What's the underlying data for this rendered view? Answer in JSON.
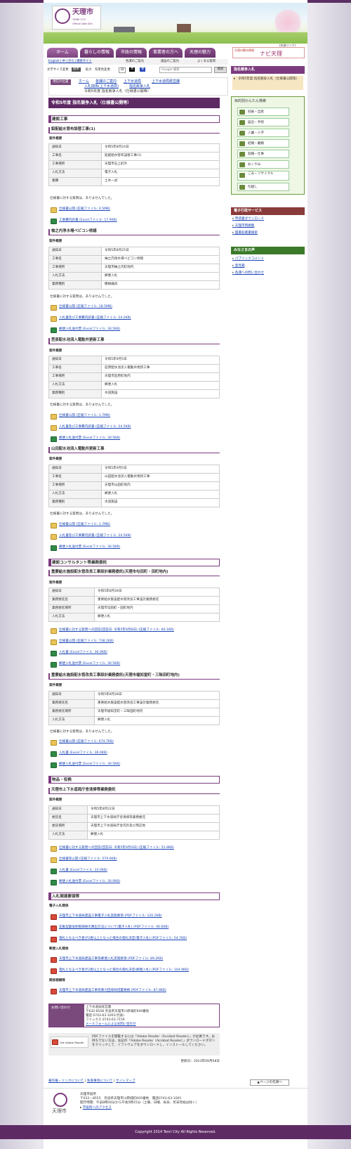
{
  "site": {
    "logo": "天理市",
    "logo_sub": "TENRI CITY",
    "logo_sub2": "Official Web Site"
  },
  "nav": [
    "ホーム",
    "暮らしの情報",
    "市政の情報",
    "事業者の方へ",
    "天理の魅力"
  ],
  "naviban": {
    "small": "天理の観光情報",
    "big": "ナビ天理",
    "tag": "(外部リンク)"
  },
  "util": {
    "lang": "English | 中 | 한국 | 携帯サイト",
    "l1": "各課のご案内",
    "l2": "施設のご案内",
    "l3": "よくある質問"
  },
  "tool": {
    "size_label": "文字サイズ変更",
    "std": "標準",
    "big": "拡大",
    "bg": "背景色変更",
    "b1": "白",
    "b2": "黒",
    "b3": "青",
    "search_ph": "Google 検索",
    "search_btn": "検索"
  },
  "crumb": {
    "label": "現在の位置",
    "c1": "ホーム",
    "c2": "各課のご案内",
    "c3": "上下水道局",
    "c4": "上下水道局経営課",
    "c5": "入札関係(上下水道局)",
    "c6": "指名競争入札",
    "c7": "令和5年度 指名競争入札（仕様書公開等）"
  },
  "title": "令和5年度 指名競争入札（仕様書公開等）",
  "sections": {
    "s1": "建設工事",
    "s2": "建設コンサルタント等業務委託",
    "s3": "物品・役務",
    "s4": "入札関連要領等"
  },
  "overview": "案件概要",
  "noq": "仕様書に対する質問は、ありませんでした。",
  "p1": {
    "h": "鉛配給水管布設替工事(1)",
    "rows": [
      [
        "通知日",
        "令和5年8月24日"
      ],
      [
        "工事名",
        "鉛配給水管布設替工事(1)"
      ],
      [
        "工事場所",
        "天理市石上町外"
      ],
      [
        "入札方法",
        "電子入札"
      ],
      [
        "業種",
        "土木一式"
      ]
    ],
    "f1": "仕様書公開 (圧縮ファイル: 4.5MB)",
    "f2": "工事費内訳書 (Excelファイル: 17.9KB)"
  },
  "p2": {
    "h": "柚之内浄水場ベビコン修繕",
    "rows": [
      [
        "通知日",
        "令和5年8月25日"
      ],
      [
        "工事名",
        "柚之内浄水場ベビコン修繕"
      ],
      [
        "工事場所",
        "天理市柚之内町地内"
      ],
      [
        "入札方法",
        "郵便入札"
      ],
      [
        "業務種別",
        "機械器具"
      ]
    ],
    "f1": "仕様書公開 (圧縮ファイル: 18.5MB)",
    "f2": "入札書及び工事費内訳書 (圧縮ファイル: 24.2KB)",
    "f3": "郵便入札送付票 (Excelファイル: 30.5KB)"
  },
  "p3": {
    "h": "苣原配水池流入電動弁更新工事",
    "rows": [
      [
        "通知日",
        "令和5年9月5日"
      ],
      [
        "工事名",
        "苣原配水池流入電動弁更新工事"
      ],
      [
        "工事場所",
        "天理市苣原町地内"
      ],
      [
        "入札方法",
        "郵便入札"
      ],
      [
        "業務種別",
        "水道施設"
      ]
    ],
    "f1": "仕様書公開 (圧縮ファイル: 1.7MB)",
    "f2": "入札書及び工事費内訳書 (圧縮ファイル: 24.5KB)",
    "f3": "郵便入札送付票 (Excelファイル: 30.5KB)"
  },
  "p4": {
    "h": "山田配水池流入電動弁更新工事",
    "rows": [
      [
        "通知日",
        "令和5年9月5日"
      ],
      [
        "工事名",
        "山田配水池流入電動弁更新工事"
      ],
      [
        "工事場所",
        "天理市山田町地内"
      ],
      [
        "入札方法",
        "郵便入札"
      ],
      [
        "業務種別",
        "水道施設"
      ]
    ],
    "f1": "仕様書公開 (圧縮ファイル: 1.7MB)",
    "f2": "入札書及び工事費内訳書 (圧縮ファイル: 24.5KB)",
    "f3": "郵便入札送付票 (Excelファイル: 30.5KB)"
  },
  "p5": {
    "h": "重要給水施設配水管改良工事設計業務委託(天理市勾田町・田町地内)",
    "rows": [
      [
        "通知日",
        "令和5年8月28日"
      ],
      [
        "業務委託名",
        "重要給水施設配水管改良工事設計業務委託"
      ],
      [
        "業務委託場所",
        "天理市勾田町・田町地内"
      ],
      [
        "入札方法",
        "郵便入札"
      ]
    ],
    "f0": "仕様書に対する質問への回答(回答日: 令和5年9月8日) (圧縮ファイル: 60.1KB)",
    "f1": "仕様書公開 (圧縮ファイル: 738.2KB)",
    "f2": "入札書 (Excelファイル: 36.0KB)",
    "f3": "郵便入札送付票 (Excelファイル: 30.5KB)"
  },
  "p6": {
    "h": "重要給水施設配水管改良工事設計業務委託(天理市福知堂町・三昧田町地内)",
    "rows": [
      [
        "通知日",
        "令和5年8月28日"
      ],
      [
        "業務委託名",
        "重要給水施設配水管改良工事設計業務委託"
      ],
      [
        "業務委託場所",
        "天理市福知堂町・三昧田町地内"
      ],
      [
        "入札方法",
        "郵便入札"
      ]
    ],
    "f1": "仕様書公開 (圧縮ファイル: 674.7KB)",
    "f2": "入札書 (Excelファイル: 36.0KB)",
    "f3": "郵便入札送付票 (Excelファイル: 30.5KB)"
  },
  "p7": {
    "h": "天理市上下水道局庁舎清掃等業務委託",
    "rows": [
      [
        "通知日",
        "令和5年8月22日"
      ],
      [
        "委託名",
        "天理市上下水道局庁舎清掃等業務委託"
      ],
      [
        "委託場所",
        "天理市上下水道局庁舎内外及び周辺地"
      ],
      [
        "入札方法",
        "郵便入札"
      ]
    ],
    "f0": "仕様書に対する質問への回答(回答日: 令和5年9月4日) (圧縮ファイル: 52.8KB)",
    "f1": "仕様書等公開 (圧縮ファイル: 579.6KB)",
    "f2": "入札書 (Excelファイル: 33.0KB)",
    "f3": "郵便入札送付票 (Excelファイル: 30.0KB)"
  },
  "rel": {
    "h1": "電子入札関係",
    "e1": "天理市上下水道局建設工事電子入札実施要領 (PDFファイル: 120.2KB)",
    "e2": "変動型最低制限価格の算出方法について(電子入札) (PDFファイル: 46.6KB)",
    "e3": "落札となるべき者が2者以上となった場合の落札決定(電子入札) (PDFファイル: 54.7KB)",
    "h2": "郵便入札関係",
    "m1": "天理市上下水道局建設工事等郵便入札実施要領 (PDFファイル: 89.2KB)",
    "m2": "落札となるべき者が2者以上となった場合の落札決定(郵便入札) (PDFファイル: 104.9KB)",
    "h3": "関係要綱等",
    "k1": "天理市上下水道局建設工事等暴力団排除措置要綱 (PDFファイル: 87.8KB)"
  },
  "contact": {
    "label": "お問い合わせ",
    "l1": "上下水道局経営課",
    "l2": "〒632-8558 奈良県天理市川原城町600番地",
    "l3": "電話 0743-63-1001(代表)",
    "l4": "ファックス 0743-63-7159",
    "link": "メールフォームによるお問い合わせ"
  },
  "pdf": {
    "badge": "Get Adobe Reader",
    "text": "PDFファイルを閲覧するには「Adobe Reader（Acrobat Reader）」が必要です。お持ちでない方は、左記の「Adobe Reader（Acrobat Reader）」ダウンロードボタンをクリックして、ソフトウェアをダウンロードし、インストールしてください。"
  },
  "updated": "更新日：2023年09月08日",
  "footlinks": {
    "a": "著作権・リンクについて",
    "b": "免責事項について",
    "c": "サイトマップ",
    "top": "▲ページの先頭へ"
  },
  "footer": {
    "org": "天理市役所",
    "addr": "〒632－8555　奈良県天理市川原城町605番地　電話0743-63-1001",
    "hours": "開庁時間：午前8時30分から午後5時15分（土曜、日曜、祝日、年末年始は除く）",
    "access": "市役所へのアクセス",
    "mark": "天理市"
  },
  "copyright": "Copyright 2014 Tenri City All Rights Reserved.",
  "side": {
    "h1": "指名競争入札",
    "cur": "令和5年度 指名競争入札（仕様書公開等）",
    "search_title": "目的別かんたん検索",
    "btns": [
      "妊娠・出産",
      "届出・手続",
      "入園・入学",
      "結婚・離婚",
      "就職・仕事",
      "おくやみ",
      "ごみ・リサイクル",
      "引越し"
    ],
    "h2": "電子行政サービス",
    "e": [
      "申請書ダウンロード",
      "天理市例規集",
      "図書館蔵書検索"
    ],
    "h3": "みなさまの声",
    "v": [
      "パブリックコメント",
      "意見箱",
      "各課への問い合わせ"
    ]
  }
}
